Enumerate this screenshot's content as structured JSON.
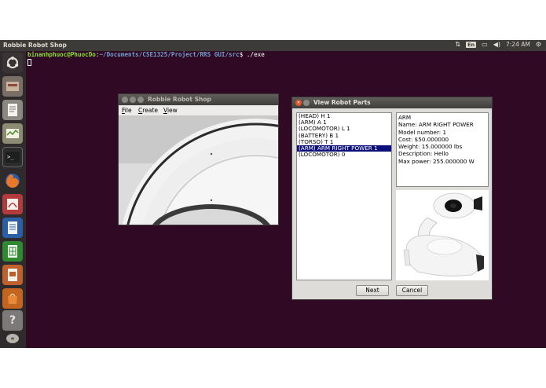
{
  "top_panel": {
    "title": "Robbie Robot Shop",
    "keyboard_layout": "En",
    "clock": "7:24 AM"
  },
  "launcher": {
    "items": [
      "ubuntu-logo-icon",
      "files-icon",
      "text-editor-icon",
      "system-monitor-icon",
      "terminal-icon",
      "firefox-icon",
      "tweak-icon",
      "writer-icon",
      "calc-icon",
      "impress-icon",
      "software-center-icon",
      "help-icon",
      "disk-icon"
    ]
  },
  "terminal": {
    "user_host": "binanhphuoc@PhuocDo",
    "path": "~/Documents/CSE1325/Project/RRS GUI/src",
    "prompt_symbol": "$",
    "command": "./exe"
  },
  "shop_window": {
    "title": "Robbie Robot Shop",
    "menus": [
      "File",
      "Create",
      "View"
    ]
  },
  "parts_window": {
    "title": "View Robot Parts",
    "parts": [
      "(HEAD) H 1",
      "(ARM) A 1",
      "(LOCOMOTOR) L 1",
      "(BATTERY) B 1",
      "(TORSO) T 1",
      "(ARM) ARM RIGHT POWER 1",
      "(LOCOMOTOR)  0"
    ],
    "selected_index": 5,
    "details": [
      "ARM",
      "Name: ARM RIGHT POWER",
      "Model number: 1",
      "Cost: $50.000000",
      "Weight: 15.000000 lbs",
      "Description: Hello",
      "Max power: 255.000000 W"
    ],
    "next_label": "Next",
    "cancel_label": "Cancel"
  },
  "colors": {
    "terminal_bg": "#300a24",
    "selection": "#0d0f7a",
    "panel": "#3c3b37"
  }
}
